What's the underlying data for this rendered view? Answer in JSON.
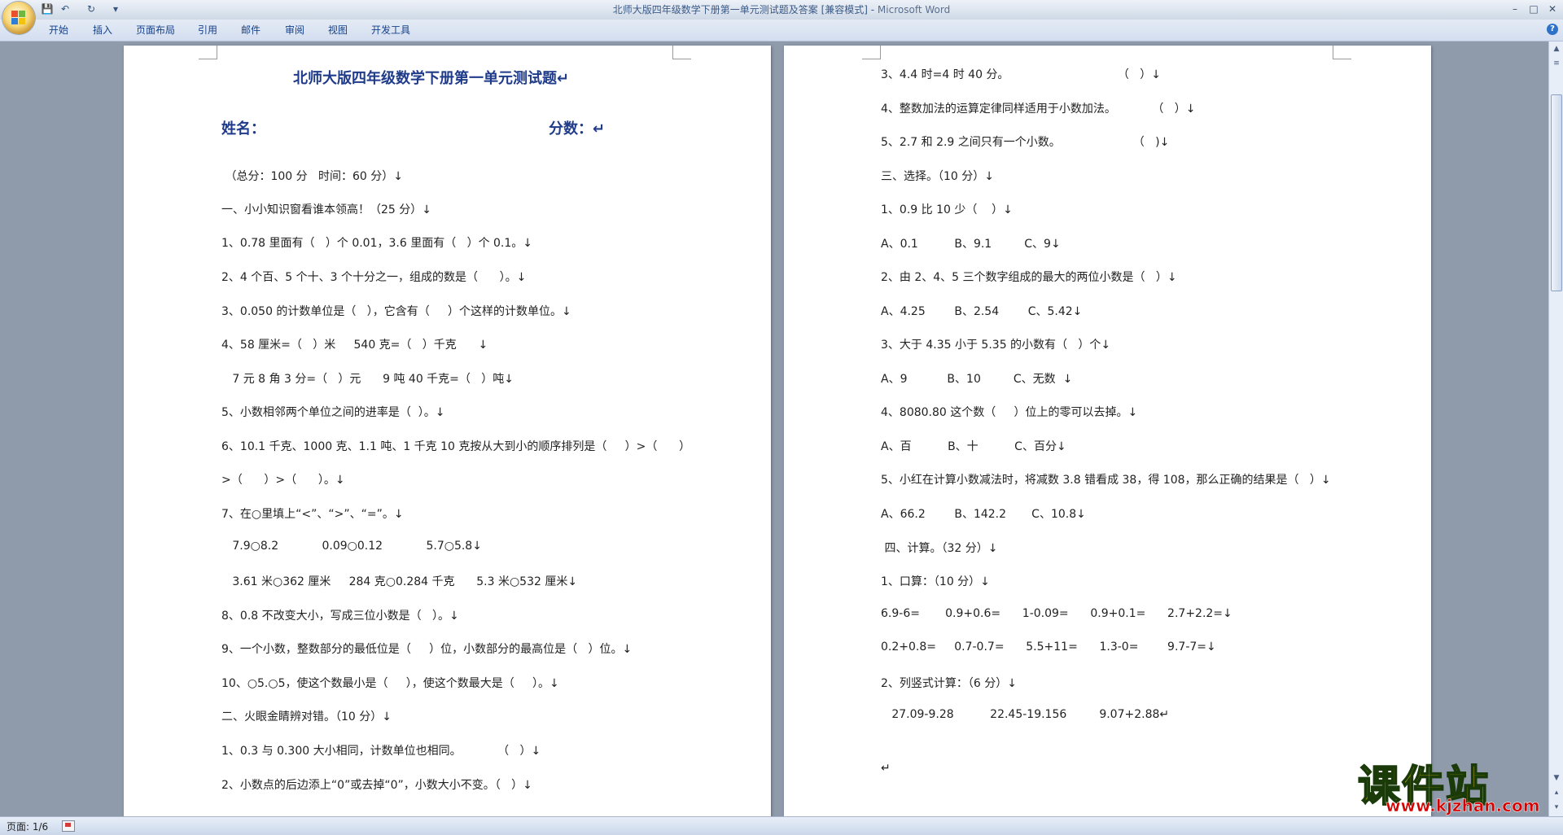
{
  "window": {
    "title": "北师大版四年级数学下册第一单元测试题及答案 [兼容模式] - ",
    "app_name": "Microsoft Word",
    "controls": {
      "minimize": "–",
      "maximize": "□",
      "close": "✕"
    }
  },
  "quick_access": {
    "save": "💾",
    "undo": "↶",
    "redo": "↻",
    "customize": "▾"
  },
  "ribbon_tabs": [
    "开始",
    "插入",
    "页面布局",
    "引用",
    "邮件",
    "审阅",
    "视图",
    "开发工具"
  ],
  "help": "?",
  "page1": {
    "title": "北师大版四年级数学下册第一单元测试题↵",
    "name_label": "姓名：",
    "score_label": "分数：↵",
    "lines": [
      " （总分：100 分   时间：60 分）↓",
      "一、小小知识窗看谁本领高！（25 分）↓",
      "1、0.78 里面有（   ）个 0.01，3.6 里面有（   ）个 0.1。↓",
      "2、4 个百、5 个十、3 个十分之一，组成的数是（      ）。↓",
      "3、0.050 的计数单位是（   ），它含有（     ）个这样的计数单位。↓",
      "4、58 厘米=（   ）米     540 克=（   ）千克      ↓",
      "   7 元 8 角 3 分=（   ）元      9 吨 40 千克=（   ）吨↓",
      "5、小数相邻两个单位之间的进率是（  ）。↓",
      "6、10.1 千克、1000 克、1.1 吨、1 千克 10 克按从大到小的顺序排列是（     ）>（      ）",
      ">（      ）>（      ）。↓",
      "7、在○里填上“<”、“>”、“=”。↓",
      "   7.9○8.2            0.09○0.12            5.7○5.8↓",
      "   3.61 米○362 厘米     284 克○0.284 千克      5.3 米○532 厘米↓",
      "8、0.8 不改变大小，写成三位小数是（   ）。↓",
      "9、一个小数，整数部分的最低位是（     ）位，小数部分的最高位是（   ）位。↓",
      "10、○5.○5，使这个数最小是（     ），使这个数最大是（     ）。↓",
      "二、火眼金睛辨对错。（10 分）↓",
      "1、0.3 与 0.300 大小相同，计数单位也相同。          （   ）↓",
      "2、小数点的后边添上“0”或去掉“0”，小数大小不变。（   ）↓"
    ]
  },
  "page2": {
    "lines": [
      "3、4.4 时=4 时 40 分。                              （   ）↓",
      "4、整数加法的运算定律同样适用于小数加法。          （   ）↓",
      "5、2.7 和 2.9 之间只有一个小数。                    （   )↓",
      "三、选择。（10 分）↓",
      "1、0.9 比 10 少（    ）↓",
      "A、0.1          B、9.1         C、9↓",
      "2、由 2、4、5 三个数字组成的最大的两位小数是（   ）↓",
      "A、4.25        B、2.54        C、5.42↓",
      "3、大于 4.35 小于 5.35 的小数有（   ）个↓",
      "A、9           B、10         C、无数  ↓",
      "4、8080.80 这个数（     ）位上的零可以去掉。↓",
      "A、百          B、十          C、百分↓",
      "5、小红在计算小数减法时，将减数 3.8 错看成 38，得 108，那么正确的结果是（   ）↓",
      "A、66.2        B、142.2       C、10.8↓",
      " 四、计算。（32 分）↓",
      "1、口算：（10 分）↓",
      "6.9-6=       0.9+0.6=      1-0.09=      0.9+0.1=      2.7+2.2=↓",
      "0.2+0.8=     0.7-0.7=      5.5+11=      1.3-0=        9.7-7=↓",
      "2、列竖式计算：（6 分）↓",
      "   27.09-9.28          22.45-19.156         9.07+2.88↵",
      "",
      "↵"
    ]
  },
  "statusbar": {
    "page": "页面: 1/6"
  },
  "scrollbar": {
    "up": "▲",
    "down": "▼",
    "prev": "▴",
    "next": "▾"
  },
  "watermark": {
    "title": "课件站",
    "url": "www.kjzhan.com"
  }
}
